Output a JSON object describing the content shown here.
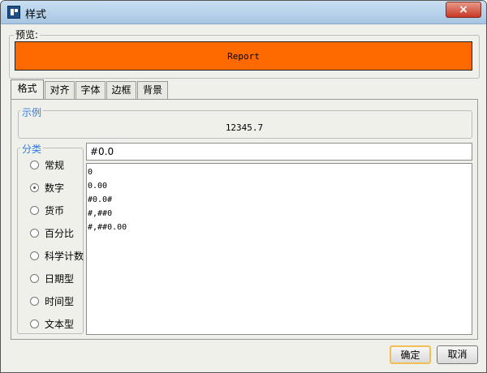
{
  "window": {
    "title": "样式",
    "close_symbol": "×"
  },
  "preview": {
    "label": "预览:",
    "text": "Report",
    "background_color": "#ff6a00"
  },
  "tabs": [
    {
      "label": "格式",
      "active": true
    },
    {
      "label": "对齐"
    },
    {
      "label": "字体"
    },
    {
      "label": "边框"
    },
    {
      "label": "背景"
    }
  ],
  "sample": {
    "label": "示例",
    "value": "12345.7"
  },
  "category": {
    "label": "分类",
    "selected": "数字",
    "items": [
      "常规",
      "数字",
      "货币",
      "百分比",
      "科学计数",
      "日期型",
      "时间型",
      "文本型"
    ]
  },
  "format": {
    "value": "#0.0",
    "options": [
      "0",
      "0.00",
      "#0.0#",
      "#,##0",
      "#,##0.00"
    ]
  },
  "buttons": {
    "ok_label": "确定",
    "cancel_label": "取消"
  },
  "colors": {
    "accent": "#2f7be2",
    "focus_border": "#f2bf54"
  }
}
